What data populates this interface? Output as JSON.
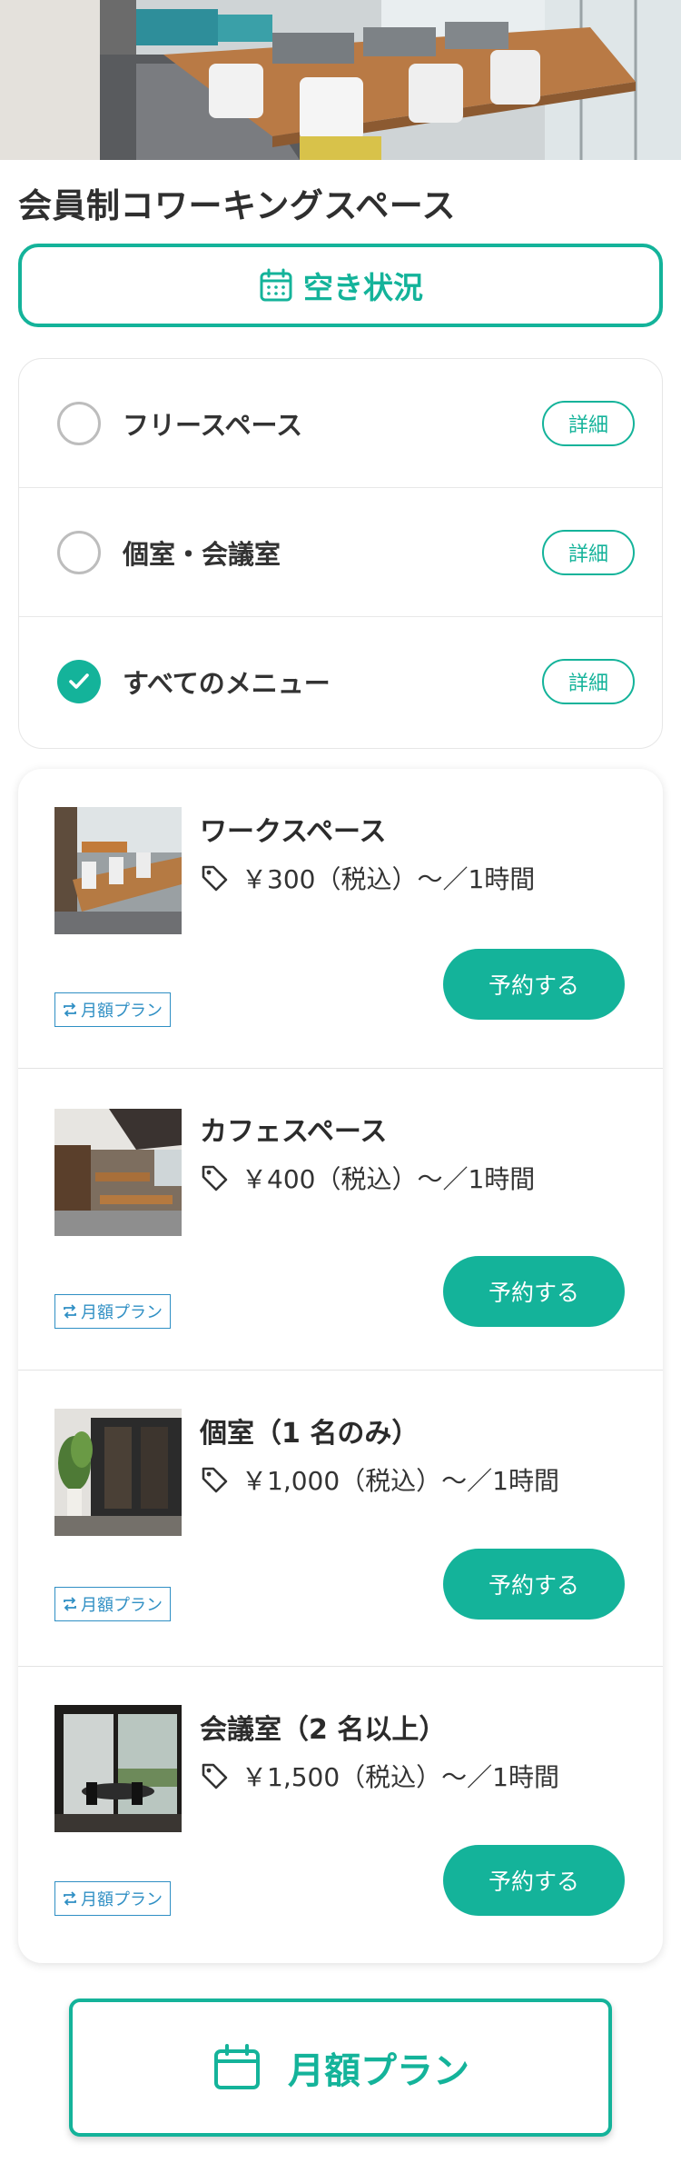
{
  "hero": {
    "image": "coworking-office-photo"
  },
  "page_title": "会員制コワーキングスペース",
  "availability_button": {
    "label": "空き状況",
    "icon": "calendar-icon"
  },
  "filters": [
    {
      "label": "フリースペース",
      "checked": false,
      "detail": "詳細"
    },
    {
      "label": "個室・会議室",
      "checked": false,
      "detail": "詳細"
    },
    {
      "label": "すべてのメニュー",
      "checked": true,
      "detail": "詳細"
    }
  ],
  "items": [
    {
      "name": "ワークスペース",
      "price": "￥300（税込）〜／1時間",
      "badge": "月額プラン",
      "reserve": "予約する",
      "thumbnail": "workspace-photo"
    },
    {
      "name": "カフェスペース",
      "price": "￥400（税込）〜／1時間",
      "badge": "月額プラン",
      "reserve": "予約する",
      "thumbnail": "cafe-space-photo"
    },
    {
      "name": "個室（1 名のみ）",
      "price": "￥1,000（税込）〜／1時間",
      "badge": "月額プラン",
      "reserve": "予約する",
      "thumbnail": "private-room-photo"
    },
    {
      "name": "会議室（2 名以上）",
      "price": "￥1,500（税込）〜／1時間",
      "badge": "月額プラン",
      "reserve": "予約する",
      "thumbnail": "meeting-room-photo"
    }
  ],
  "monthly_plan_button": {
    "label": "月額プラン",
    "icon": "calendar-icon"
  },
  "colors": {
    "accent": "#14b39a",
    "badge": "#2f8fc4",
    "text": "#2f2f2f"
  }
}
